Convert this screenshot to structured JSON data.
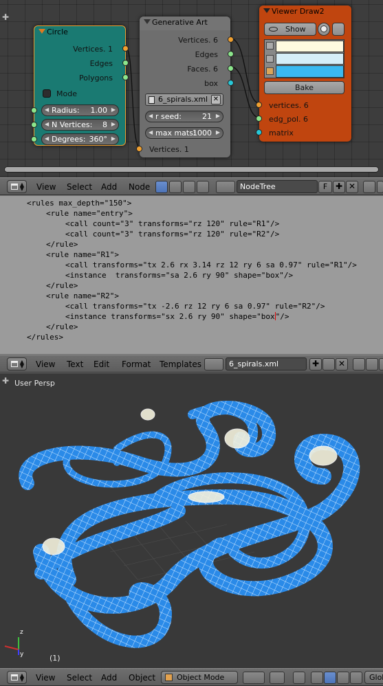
{
  "node_editor": {
    "circle_node": {
      "title": "Circle",
      "outputs": [
        "Vertices. 1",
        "Edges",
        "Polygons"
      ],
      "mode_label": "Mode",
      "fields": [
        {
          "label": "Radius:",
          "value": "1.00"
        },
        {
          "label": "N Vertices:",
          "value": "8"
        },
        {
          "label": "Degrees:",
          "value": "360°"
        }
      ]
    },
    "genart_node": {
      "title": "Generative Art",
      "outputs": [
        "Vertices. 6",
        "Edges",
        "Faces. 6",
        "box"
      ],
      "file_field": "6_spirals.xml",
      "fields": [
        {
          "label": "r seed:",
          "value": "21"
        },
        {
          "label": "max mats:",
          "value": "1000"
        }
      ],
      "input": "Vertices. 1"
    },
    "viewer_node": {
      "title": "Viewer Draw2",
      "show_label": "Show",
      "bake_label": "Bake",
      "inputs": [
        "vertices. 6",
        "edg_pol. 6",
        "matrix"
      ],
      "color_swatches": [
        "#fffbe0",
        "#d6eef8",
        "#3bb9f0"
      ]
    }
  },
  "node_header": {
    "menus": [
      "View",
      "Select",
      "Add",
      "Node"
    ],
    "tree_name": "NodeTree",
    "fake_user": "F"
  },
  "text_editor": {
    "lines": [
      {
        "indent": 0,
        "text": "<rules max_depth=\"150\">"
      },
      {
        "indent": 1,
        "text": "<rule name=\"entry\">"
      },
      {
        "indent": 2,
        "text": "<call count=\"3\" transforms=\"rz 120\" rule=\"R1\"/>"
      },
      {
        "indent": 2,
        "text": "<call count=\"3\" transforms=\"rz 120\" rule=\"R2\"/>"
      },
      {
        "indent": 1,
        "text": "</rule>"
      },
      {
        "indent": 1,
        "text": "<rule name=\"R1\">"
      },
      {
        "indent": 2,
        "text": "<call transforms=\"tx 2.6 rx 3.14 rz 12 ry 6 sa 0.97\" rule=\"R1\"/>"
      },
      {
        "indent": 2,
        "text": "<instance  transforms=\"sa 2.6 ry 90\" shape=\"box\"/>"
      },
      {
        "indent": 1,
        "text": "</rule>"
      },
      {
        "indent": 1,
        "text": "<rule name=\"R2\">"
      },
      {
        "indent": 2,
        "text": "<call transforms=\"tx -2.6 rz 12 ry 6 sa 0.97\" rule=\"R2\"/>"
      },
      {
        "indent": 2,
        "text": "<instance transforms=\"sx 2.6 ry 90\" shape=\"box\"/>"
      },
      {
        "indent": 1,
        "text": "</rule>"
      },
      {
        "indent": 0,
        "text": "</rules>"
      }
    ],
    "cursor_line": 11,
    "cursor_after": "<instance transforms=\"sx 2.6 ry 90\" shape=\"box"
  },
  "text_header": {
    "menus": [
      "View",
      "Text",
      "Edit",
      "Format",
      "Templates"
    ],
    "filename": "6_spirals.xml"
  },
  "viewport": {
    "view_label": "User Persp",
    "frame_label": "(1)",
    "mesh_color": "#2a8ae8",
    "axis_z": "z",
    "axis_y": "y"
  },
  "bottom_header": {
    "menus": [
      "View",
      "Select",
      "Add",
      "Object"
    ],
    "mode": "Object Mode",
    "glob": "Glob"
  }
}
